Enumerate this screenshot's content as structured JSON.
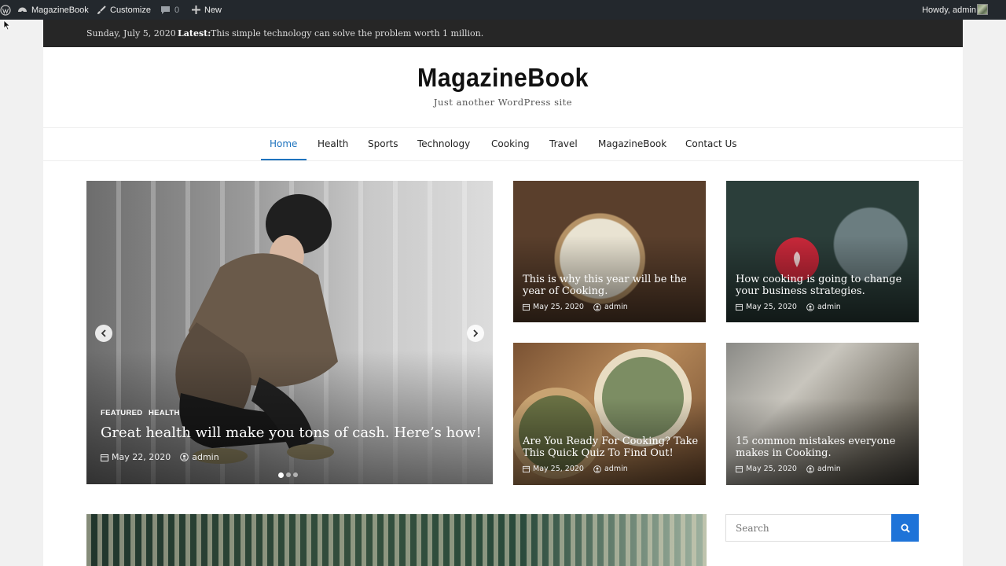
{
  "admin_bar": {
    "site_name": "MagazineBook",
    "customize": "Customize",
    "comments_count": "0",
    "new_label": "New",
    "howdy": "Howdy, admin"
  },
  "top_bar": {
    "date": "Sunday, July 5, 2020",
    "latest_label": "Latest:",
    "latest_text": "This simple technology can solve the problem worth 1 million."
  },
  "header": {
    "title": "MagazineBook",
    "tagline": "Just another WordPress site"
  },
  "nav": {
    "items": [
      "Home",
      "Health",
      "Sports",
      "Technology",
      "Cooking",
      "Travel",
      "MagazineBook",
      "Contact Us"
    ],
    "active": "Home"
  },
  "slider": {
    "categories": [
      "FEATURED",
      "HEALTH"
    ],
    "title": "Great health will make you tons of cash. Here’s how!",
    "date": "May 22, 2020",
    "author": "admin",
    "slide_count": 3,
    "active_slide": 1
  },
  "cards": [
    {
      "title": "This is why this year will be the year of Cooking.",
      "date": "May 25, 2020",
      "author": "admin"
    },
    {
      "title": "How cooking is going to change your business strategies.",
      "date": "May 25, 2020",
      "author": "admin"
    },
    {
      "title": "Are You Ready For Cooking? Take This Quick Quiz To Find Out!",
      "date": "May 25, 2020",
      "author": "admin"
    },
    {
      "title": "15 common mistakes everyone makes in Cooking.",
      "date": "May 25, 2020",
      "author": "admin"
    }
  ],
  "search": {
    "placeholder": "Search"
  },
  "colors": {
    "accent": "#1e73be",
    "admin_bar": "#23282d",
    "top_bar": "#262626"
  }
}
